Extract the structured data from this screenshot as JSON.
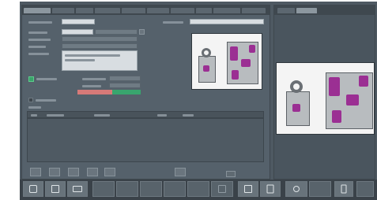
{
  "left_tabs": [
    "",
    "",
    "",
    "",
    "",
    "",
    "",
    "",
    "",
    ""
  ],
  "right_tabs": [
    "",
    ""
  ],
  "form": {
    "labels": [
      "",
      "",
      "",
      "",
      "",
      ""
    ],
    "values": [
      "",
      "",
      "",
      "",
      ""
    ],
    "right_label": "",
    "right_value": "",
    "notes": [
      "",
      ""
    ]
  },
  "options": {
    "checkbox_label": "",
    "row1_label": "",
    "row1_value": "",
    "row2_label": "",
    "row2_value": "",
    "checkbox2_label": ""
  },
  "table": {
    "title": "",
    "headers": [
      "",
      "",
      "",
      "",
      ""
    ]
  },
  "status_colors": {
    "error": "#d77a78",
    "ok": "#39a56e"
  },
  "toolbar_icons": [
    "camera-icon",
    "print-icon",
    "display-icon",
    "grid-icon",
    "grid-icon",
    "grid-icon",
    "grid-icon",
    "grid-icon",
    "grid-icon",
    "save-icon",
    "export-icon",
    "document-icon",
    "person-icon",
    "phone-icon"
  ]
}
